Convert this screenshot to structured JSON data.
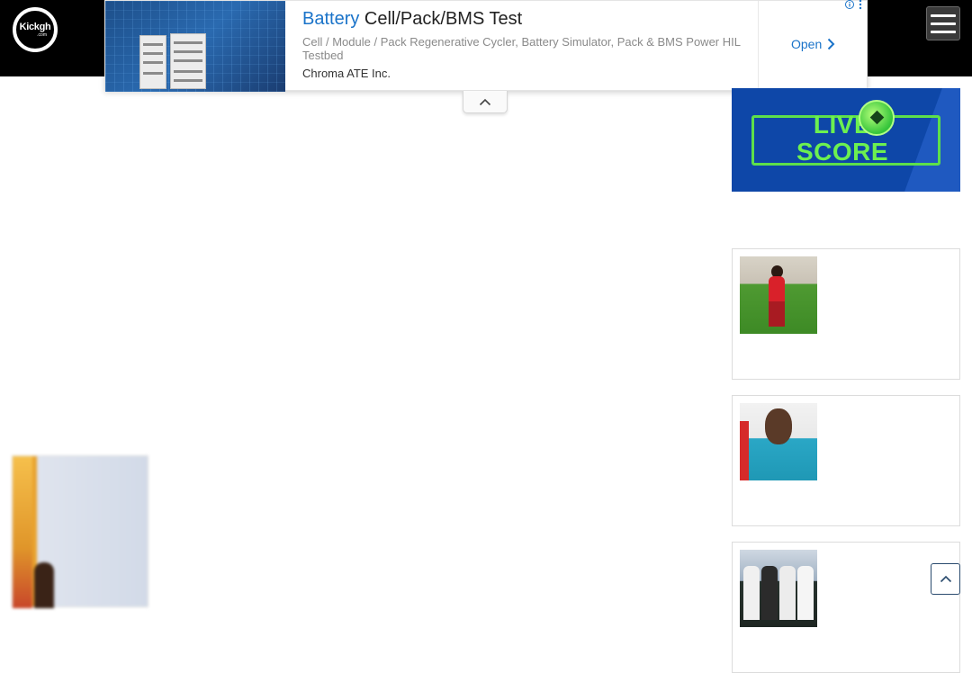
{
  "header": {
    "logo_text": "Kickgh",
    "logo_sub": ".com",
    "menu_icon": "hamburger-icon"
  },
  "ad": {
    "title_highlight": "Battery",
    "title_rest": " Cell/Pack/BMS Test",
    "description": "Cell / Module / Pack Regenerative Cycler, Battery Simulator, Pack & BMS Power HIL Testbed",
    "company": "Chroma ATE Inc.",
    "open_label": "Open",
    "info_icon": "info-icon",
    "collapse_icon": "chevron-up-icon"
  },
  "sidebar": {
    "live_score_line1": "LIVE",
    "live_score_line2": "SCORE"
  },
  "colors": {
    "accent": "#1a73c9",
    "header_bg": "#000000",
    "live_score_bg": "#0e47a8",
    "live_score_text": "#6cf050"
  },
  "scroll_top_icon": "chevron-up-icon"
}
